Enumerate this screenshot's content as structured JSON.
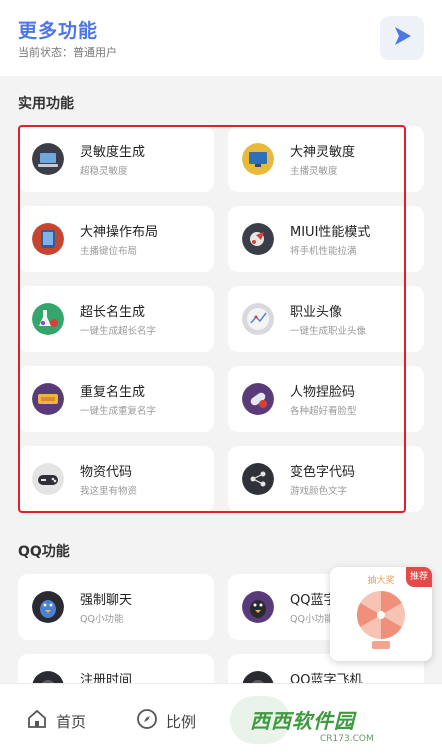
{
  "header": {
    "title": "更多功能",
    "status": "当前状态：普通用户",
    "play_icon": "play-triangle-icon",
    "accent": "#4e77e6"
  },
  "sections": {
    "practical_title": "实用功能",
    "qq_title": "QQ功能"
  },
  "practical": [
    {
      "name": "灵敏度生成",
      "desc": "超稳灵敏度",
      "icon": "laptop-icon"
    },
    {
      "name": "大神灵敏度",
      "desc": "主播灵敏度",
      "icon": "monitor-icon"
    },
    {
      "name": "大神操作布局",
      "desc": "主播键位布局",
      "icon": "tablet-icon"
    },
    {
      "name": "MIUI性能模式",
      "desc": "将手机性能拉满",
      "icon": "rocket-icon"
    },
    {
      "name": "超长名生成",
      "desc": "一键生成超长名字",
      "icon": "flask-icon"
    },
    {
      "name": "职业头像",
      "desc": "一键生成职业头像",
      "icon": "chart-icon"
    },
    {
      "name": "重复名生成",
      "desc": "一键生成重复名字",
      "icon": "ticket-icon"
    },
    {
      "name": "人物捏脸码",
      "desc": "各种超好看脸型",
      "icon": "pill-icon"
    },
    {
      "name": "物资代码",
      "desc": "我这里有物资",
      "icon": "gamepad-icon"
    },
    {
      "name": "变色字代码",
      "desc": "游戏颜色文字",
      "icon": "share-icon"
    }
  ],
  "qq": [
    {
      "name": "强制聊天",
      "desc": "QQ小功能",
      "icon": "penguin-icon"
    },
    {
      "name": "QQ蓝字",
      "desc": "QQ小功能",
      "icon": "penguin-icon"
    },
    {
      "name": "注册时间",
      "desc": "",
      "icon": "penguin-icon"
    },
    {
      "name": "QQ蓝字飞机",
      "desc": "",
      "icon": "penguin-icon"
    }
  ],
  "popup": {
    "title": "抽大奖",
    "tag": "推荐"
  },
  "bottom_nav": {
    "home": "首页",
    "ratio": "比例",
    "watermark": "西西软件园",
    "watermark_sub": "CR173.COM"
  },
  "colors": {
    "highlight": "#e0202a",
    "card_bg": "#ffffff",
    "page_bg": "#f3f3f3"
  }
}
